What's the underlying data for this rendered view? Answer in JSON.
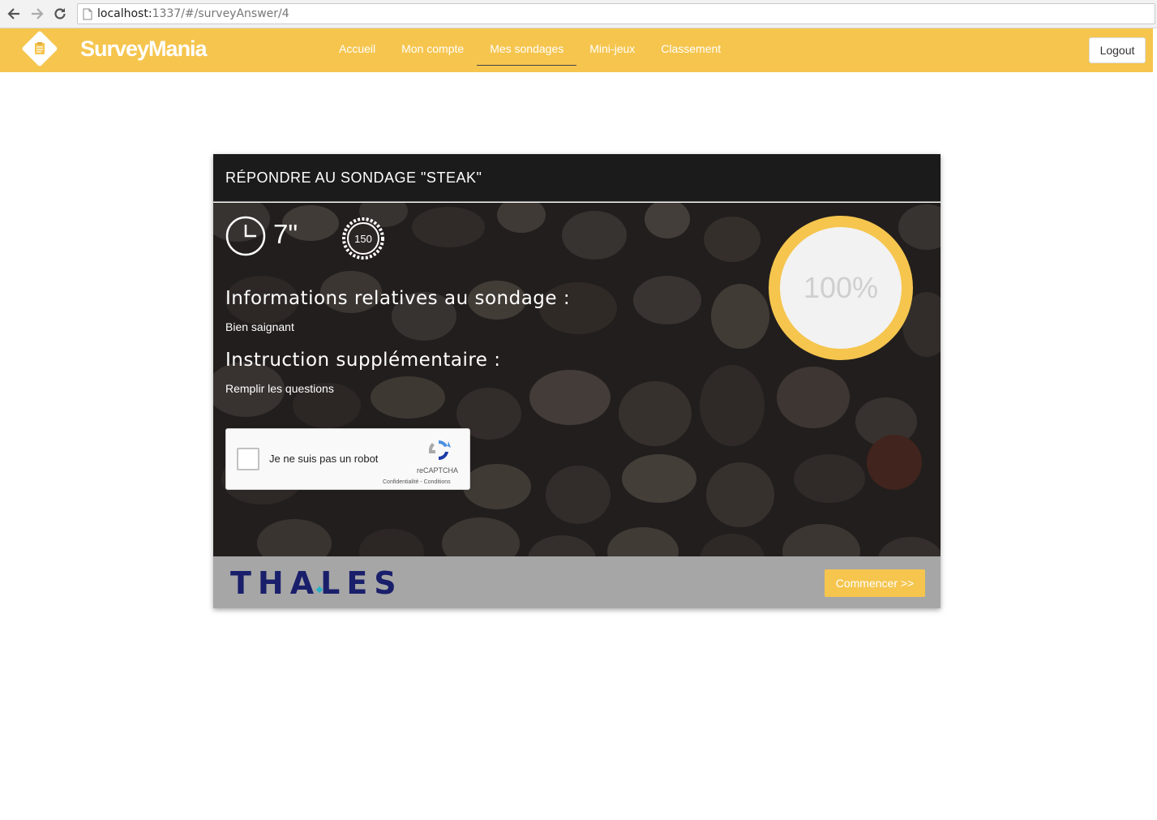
{
  "browser": {
    "url_host": "localhost:",
    "url_rest": "1337/#/surveyAnswer/4"
  },
  "header": {
    "brand": "SurveyMania",
    "nav": [
      {
        "label": "Accueil"
      },
      {
        "label": "Mon compte"
      },
      {
        "label": "Mes sondages",
        "active": true
      },
      {
        "label": "Mini-jeux"
      },
      {
        "label": "Classement"
      }
    ],
    "logout_label": "Logout",
    "accent_color": "#f5c54e"
  },
  "card": {
    "title": "RÉPONDRE AU SONDAGE \"STEAK\"",
    "timer": "7\"",
    "points": "150",
    "info_heading": "Informations relatives au sondage :",
    "info_text": "Bien saignant",
    "instruction_heading": "Instruction supplémentaire :",
    "instruction_text": "Remplir les questions",
    "progress": {
      "value": 100,
      "label": "100%"
    },
    "captcha": {
      "label": "Je ne suis pas un robot",
      "brand": "reCAPTCHA",
      "links": "Confidentialité - Conditions",
      "checked": false
    },
    "sponsor": "THALES",
    "start_label": "Commencer >>"
  }
}
